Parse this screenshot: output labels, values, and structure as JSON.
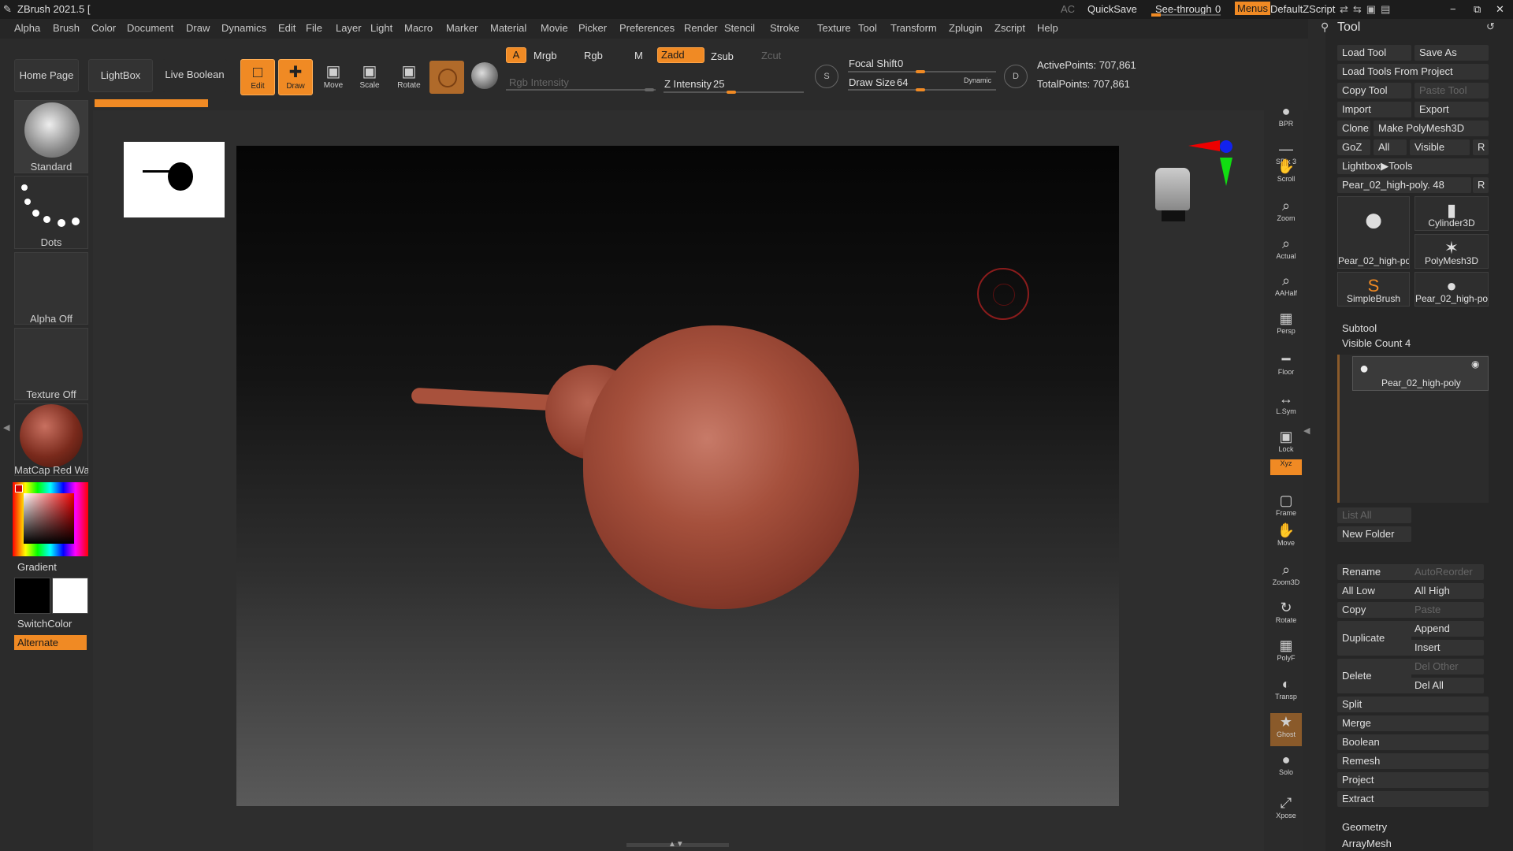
{
  "window": {
    "title": "ZBrush 2021.5 [",
    "ac_label": "AC",
    "quicksave": "QuickSave",
    "see_through_label": "See-through",
    "see_through_value": "0",
    "menus_label": "Menus",
    "default_script": "DefaultZScript"
  },
  "menu": [
    "Alpha",
    "Brush",
    "Color",
    "Document",
    "Draw",
    "Dynamics",
    "Edit",
    "File",
    "Layer",
    "Light",
    "Macro",
    "Marker",
    "Material",
    "Movie",
    "Picker",
    "Preferences",
    "Render",
    "Stencil",
    "Stroke",
    "Texture",
    "Tool",
    "Transform",
    "Zplugin",
    "Zscript",
    "Help"
  ],
  "toolbar": {
    "home_page": "Home Page",
    "lightbox": "LightBox",
    "live_boolean": "Live Boolean",
    "edit": "Edit",
    "draw": "Draw",
    "move": "Move",
    "scale": "Scale",
    "rotate": "Rotate",
    "a_label": "A",
    "mrgb": "Mrgb",
    "rgb": "Rgb",
    "m": "M",
    "zadd": "Zadd",
    "zsub": "Zsub",
    "zcut": "Zcut",
    "rgb_intensity": "Rgb Intensity",
    "z_intensity_label": "Z Intensity",
    "z_intensity_value": "25",
    "focal_shift_label": "Focal Shift",
    "focal_shift_value": "0",
    "draw_size_label": "Draw Size",
    "draw_size_value": "64",
    "dynamic": "Dynamic",
    "active_points": "ActivePoints: 707,861",
    "total_points": "TotalPoints: 707,861"
  },
  "left_tray": {
    "brush": "Standard",
    "stroke": "Dots",
    "alpha": "Alpha Off",
    "texture": "Texture Off",
    "material": "MatCap Red Wax",
    "gradient": "Gradient",
    "switch_color": "SwitchColor",
    "alternate": "Alternate"
  },
  "right_shelf": [
    {
      "label": "BPR",
      "icon": "bpr-icon"
    },
    {
      "label": "SPix 3",
      "icon": "spix-icon"
    },
    {
      "label": "Scroll",
      "icon": "scroll-icon"
    },
    {
      "label": "Zoom",
      "icon": "zoom-icon"
    },
    {
      "label": "Actual",
      "icon": "actual-icon"
    },
    {
      "label": "AAHalf",
      "icon": "aahalf-icon"
    },
    {
      "label": "Persp",
      "icon": "persp-icon"
    },
    {
      "label": "Floor",
      "icon": "floor-icon"
    },
    {
      "label": "L.Sym",
      "icon": "lsym-icon"
    },
    {
      "label": "Lock",
      "icon": "lock-icon"
    },
    {
      "label": "Xyz",
      "icon": "xyz-icon"
    },
    {
      "label": "Frame",
      "icon": "frame-icon"
    },
    {
      "label": "Move",
      "icon": "move-icon"
    },
    {
      "label": "Zoom3D",
      "icon": "zoom3d-icon"
    },
    {
      "label": "Rotate",
      "icon": "rotate-icon"
    },
    {
      "label": "PolyF",
      "icon": "polyf-icon"
    },
    {
      "label": "Transp",
      "icon": "transp-icon"
    },
    {
      "label": "Ghost",
      "icon": "ghost-icon"
    },
    {
      "label": "Solo",
      "icon": "solo-icon"
    },
    {
      "label": "Xpose",
      "icon": "xpose-icon"
    }
  ],
  "tool_panel": {
    "title": "Tool",
    "load_tool": "Load Tool",
    "save_as": "Save As",
    "load_tools_from_project": "Load Tools From Project",
    "copy_tool": "Copy Tool",
    "paste_tool": "Paste Tool",
    "import": "Import",
    "export": "Export",
    "clone": "Clone",
    "make_polymesh": "Make PolyMesh3D",
    "goz": "GoZ",
    "all": "All",
    "visible": "Visible",
    "r": "R",
    "lightbox_tools": "Lightbox▶Tools",
    "current_tool": "Pear_02_high-poly. 48",
    "thumbs": [
      "Pear_02_high-po",
      "Cylinder3D",
      "PolyMesh3D",
      "SimpleBrush",
      "Pear_02_high-po"
    ],
    "subtool_header": "Subtool",
    "visible_count": "Visible Count 4",
    "subtool_name": "Pear_02_high-poly",
    "list_all": "List All",
    "new_folder": "New Folder",
    "rename": "Rename",
    "autoreorder": "AutoReorder",
    "all_low": "All Low",
    "all_high": "All High",
    "copy": "Copy",
    "paste": "Paste",
    "duplicate": "Duplicate",
    "append": "Append",
    "insert": "Insert",
    "delete": "Delete",
    "del_other": "Del Other",
    "del_all": "Del All",
    "split": "Split",
    "merge": "Merge",
    "boolean": "Boolean",
    "remesh": "Remesh",
    "project": "Project",
    "extract": "Extract",
    "geometry": "Geometry",
    "arraymesh": "ArrayMesh"
  }
}
